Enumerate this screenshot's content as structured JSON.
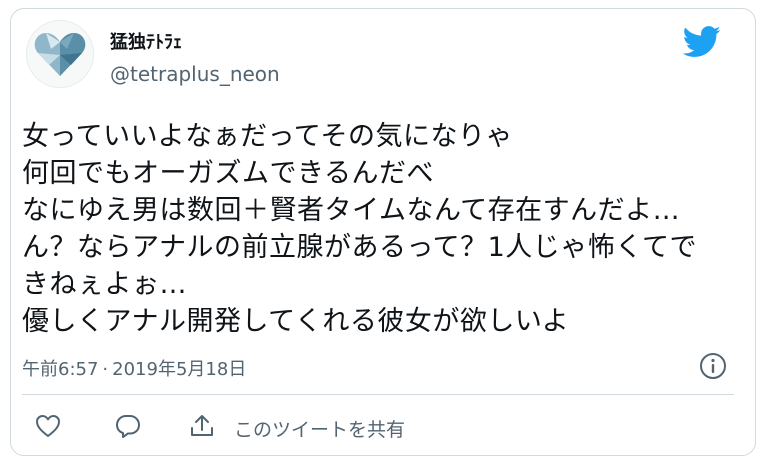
{
  "user": {
    "display_name": "猛独ﾃﾄﾗｪ",
    "handle": "@tetraplus_neon",
    "avatar_icon": "heart-logo-icon"
  },
  "brand": {
    "icon": "twitter-bird-icon",
    "color": "#1da1f2"
  },
  "tweet": {
    "text": "女っていいよなぁだってその気になりゃ\n何回でもオーガズムできるんだべ\nなにゆえ男は数回＋賢者タイムなんて存在すんだよ…\nん？ならアナルの前立腺があるって？1人じゃ怖くてで\nきねぇよぉ…\n優しくアナル開発してくれる彼女が欲しいよ",
    "time": "午前6:57",
    "separator": "·",
    "date": "2019年5月18日"
  },
  "actions": {
    "like_icon": "heart-icon",
    "reply_icon": "comment-icon",
    "share_icon": "share-icon",
    "share_label": "このツイートを共有",
    "info_icon": "info-icon"
  }
}
